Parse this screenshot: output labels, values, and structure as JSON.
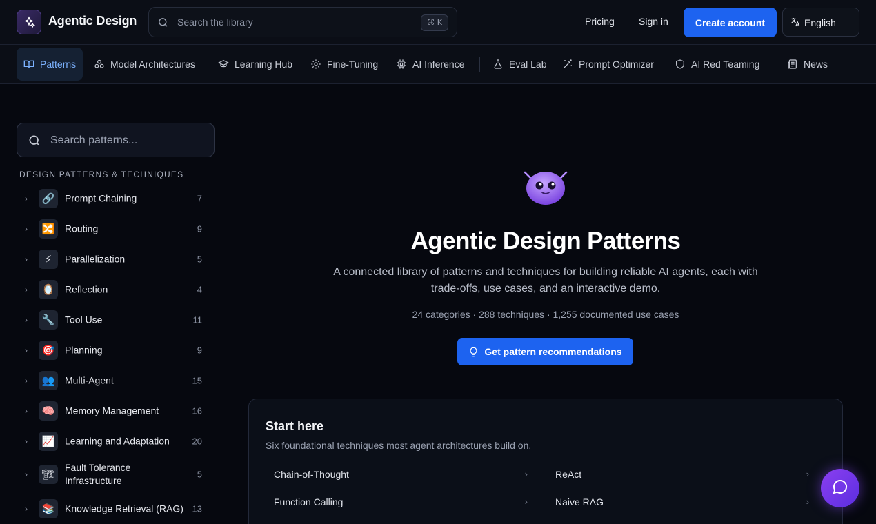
{
  "header": {
    "brand": "Agentic Design",
    "search_placeholder": "Search the library",
    "search_shortcut": "⌘ K",
    "pricing": "Pricing",
    "sign_in": "Sign in",
    "create_account": "Create account",
    "language": "English"
  },
  "tabs": [
    {
      "label": "Patterns",
      "icon": "book-open-icon",
      "active": true
    },
    {
      "label": "Model Architectures",
      "icon": "network-icon"
    },
    {
      "label": "Learning Hub",
      "icon": "graduation-cap-icon"
    },
    {
      "label": "Fine-Tuning",
      "icon": "gear-icon"
    },
    {
      "label": "AI Inference",
      "icon": "cpu-icon"
    },
    {
      "label": "Eval Lab",
      "icon": "flask-icon"
    },
    {
      "label": "Prompt Optimizer",
      "icon": "magic-wand-icon"
    },
    {
      "label": "AI Red Teaming",
      "icon": "shield-icon"
    },
    {
      "label": "News",
      "icon": "newspaper-icon"
    }
  ],
  "sidebar": {
    "search_placeholder": "Search patterns...",
    "heading": "DESIGN PATTERNS & TECHNIQUES",
    "categories": [
      {
        "emoji": "🔗",
        "label": "Prompt Chaining",
        "count": "7"
      },
      {
        "emoji": "🔀",
        "label": "Routing",
        "count": "9"
      },
      {
        "emoji": "⚡",
        "label": "Parallelization",
        "count": "5"
      },
      {
        "emoji": "🪞",
        "label": "Reflection",
        "count": "4"
      },
      {
        "emoji": "🔧",
        "label": "Tool Use",
        "count": "11"
      },
      {
        "emoji": "🎯",
        "label": "Planning",
        "count": "9"
      },
      {
        "emoji": "👥",
        "label": "Multi-Agent",
        "count": "15"
      },
      {
        "emoji": "🧠",
        "label": "Memory Management",
        "count": "16"
      },
      {
        "emoji": "📈",
        "label": "Learning and Adaptation",
        "count": "20"
      },
      {
        "emoji": "🏗",
        "label": "Fault Tolerance Infrastructure",
        "count": "5"
      },
      {
        "emoji": "📚",
        "label": "Knowledge Retrieval (RAG)",
        "count": "13"
      }
    ]
  },
  "hero": {
    "title": "Agentic Design Patterns",
    "description": "A connected library of patterns and techniques for building reliable AI agents, each with trade-offs, use cases, and an interactive demo.",
    "stats": "24 categories · 288 techniques · 1,255 documented use cases",
    "cta": "Get pattern recommendations"
  },
  "start_here": {
    "title": "Start here",
    "subtitle": "Six foundational techniques most agent architectures build on.",
    "items": [
      "Chain-of-Thought",
      "ReAct",
      "Function Calling",
      "Naive RAG"
    ]
  },
  "colors": {
    "accent": "#1d63f0",
    "background": "#06080f",
    "active_tab": "#7cb2ff"
  }
}
